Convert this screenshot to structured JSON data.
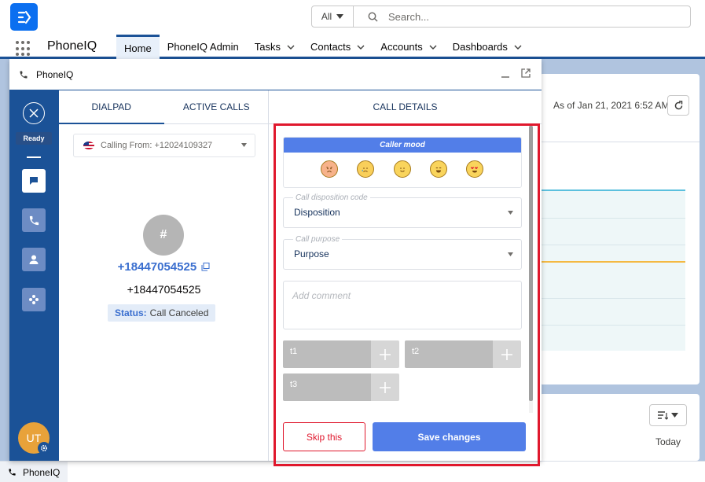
{
  "header": {
    "search_scope": "All",
    "search_placeholder": "Search..."
  },
  "nav": {
    "app_name": "PhoneIQ",
    "items": [
      {
        "label": "Home",
        "active": true,
        "chevron": false
      },
      {
        "label": "PhoneIQ Admin",
        "active": false,
        "chevron": false
      },
      {
        "label": "Tasks",
        "active": false,
        "chevron": true
      },
      {
        "label": "Contacts",
        "active": false,
        "chevron": true
      },
      {
        "label": "Accounts",
        "active": false,
        "chevron": true
      },
      {
        "label": "Dashboards",
        "active": false,
        "chevron": true
      }
    ]
  },
  "background": {
    "as_of": "As of Jan 21, 2021 6:52 AM",
    "today_label": "Today"
  },
  "panel": {
    "title": "PhoneIQ",
    "sidebar": {
      "ready_label": "Ready",
      "avatar_initials": "UT"
    },
    "tabs": {
      "dialpad": "DIALPAD",
      "active_calls": "ACTIVE CALLS",
      "call_details": "CALL DETAILS"
    },
    "calling_from": "Calling From: +12024109327",
    "contact": {
      "avatar_symbol": "#",
      "link_number": "+18447054525",
      "number": "+18447054525",
      "status_label": "Status:",
      "status_value": "Call Canceled"
    },
    "details": {
      "mood_title": "Caller mood",
      "disposition_label": "Call disposition code",
      "disposition_value": "Disposition",
      "purpose_label": "Call purpose",
      "purpose_value": "Purpose",
      "comment_placeholder": "Add comment",
      "tags": [
        "t1",
        "t2",
        "t3"
      ],
      "skip_label": "Skip this",
      "save_label": "Save changes"
    }
  },
  "utility_bar": {
    "label": "PhoneIQ"
  },
  "colors": {
    "brand_blue": "#1b5297",
    "accent_blue": "#527ee8",
    "highlight_red": "#e0182d",
    "avatar_orange": "#e8a23a"
  }
}
